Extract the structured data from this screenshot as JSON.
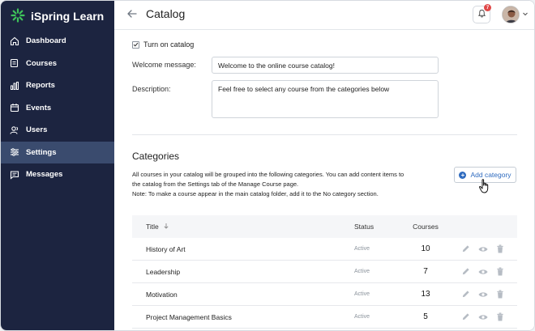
{
  "app": {
    "name": "iSpring Learn"
  },
  "sidebar": {
    "items": [
      {
        "label": "Dashboard",
        "icon": "home-icon"
      },
      {
        "label": "Courses",
        "icon": "courses-icon"
      },
      {
        "label": "Reports",
        "icon": "reports-icon"
      },
      {
        "label": "Events",
        "icon": "calendar-icon"
      },
      {
        "label": "Users",
        "icon": "users-icon"
      },
      {
        "label": "Settings",
        "icon": "settings-icon",
        "active": true
      },
      {
        "label": "Messages",
        "icon": "messages-icon"
      }
    ]
  },
  "header": {
    "title": "Catalog",
    "notification_count": "7"
  },
  "form": {
    "catalog_checkbox_label": "Turn on catalog",
    "catalog_checked": true,
    "welcome_label": "Welcome message:",
    "welcome_value": "Welcome to the online course catalog!",
    "description_label": "Description:",
    "description_value": "Feel free to select any course from the categories below"
  },
  "categories": {
    "title": "Categories",
    "desc_line1": "All courses in your catalog will be grouped into the following categories. You can add content items to",
    "desc_line2": "the catalog from the Settings tab of the Manage Course page.",
    "desc_line3": "Note: To make a course appear in the main catalog folder, add it to the No category section.",
    "add_button": "Add category"
  },
  "table": {
    "headers": {
      "title": "Title",
      "status": "Status",
      "courses": "Courses"
    },
    "rows": [
      {
        "title": "History of Art",
        "status": "Active",
        "courses": "10"
      },
      {
        "title": "Leadership",
        "status": "Active",
        "courses": "7"
      },
      {
        "title": "Motivation",
        "status": "Active",
        "courses": "13"
      },
      {
        "title": "Project Management Basics",
        "status": "Active",
        "courses": "5"
      }
    ]
  },
  "colors": {
    "sidebar_bg": "#1c2440",
    "sidebar_active": "#3a4b6e",
    "accent": "#2f6bbf",
    "logo_green": "#3ec25a",
    "badge_red": "#e04848"
  }
}
